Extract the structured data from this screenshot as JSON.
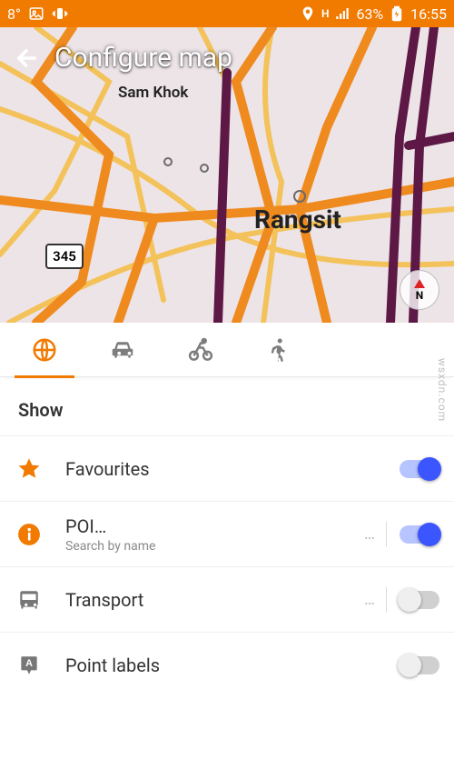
{
  "status": {
    "temp": "8°",
    "network_label": "H",
    "battery_pct": "63%",
    "time": "16:55"
  },
  "header": {
    "title": "Configure map"
  },
  "map": {
    "place_a": "Sam Khok",
    "place_b": "Rangsit",
    "route_number": "345",
    "compass_label": "N"
  },
  "tabs": {
    "active_index": 0,
    "items": [
      "browse",
      "car",
      "bicycle",
      "walk"
    ]
  },
  "section": {
    "title": "Show"
  },
  "rows": {
    "favourites": {
      "title": "Favourites",
      "on": true
    },
    "poi": {
      "title": "POI…",
      "subtitle": "Search by name",
      "more": "…",
      "on": true
    },
    "transport": {
      "title": "Transport",
      "more": "…",
      "on": false
    },
    "labels": {
      "title": "Point labels",
      "on": false
    }
  },
  "watermark": "wsxdn.com"
}
